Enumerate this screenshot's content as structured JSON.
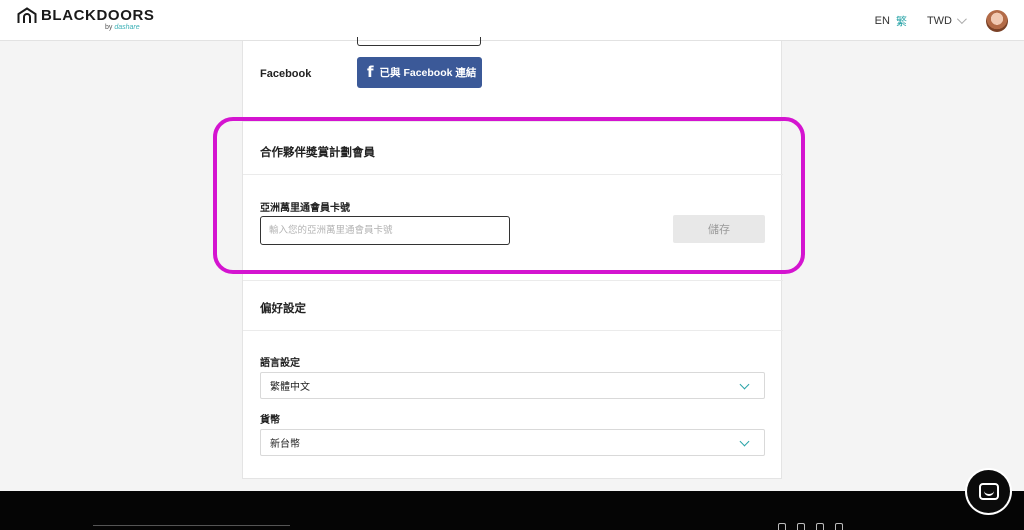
{
  "header": {
    "logo_text": "BLACKDOORS",
    "logo_sub_prefix": "by ",
    "logo_sub_brand": "dashare",
    "lang_en": "EN",
    "lang_zh": "繁",
    "currency": "TWD"
  },
  "social": {
    "facebook_label": "Facebook",
    "facebook_button": "已與 Facebook 連結",
    "facebook_glyph": "f"
  },
  "partner": {
    "title": "合作夥伴獎賞計劃會員",
    "field_label": "亞洲萬里通會員卡號",
    "input_value": "",
    "input_placeholder": "輸入您的亞洲萬里通會員卡號",
    "save_label": "儲存"
  },
  "preferences": {
    "title": "偏好設定",
    "language_label": "語言設定",
    "language_value": "繁體中文",
    "currency_label": "貨幣",
    "currency_value": "新台幣"
  },
  "colors": {
    "highlight": "#d414d0",
    "facebook": "#3b5998",
    "accent": "#2aa4a8"
  }
}
